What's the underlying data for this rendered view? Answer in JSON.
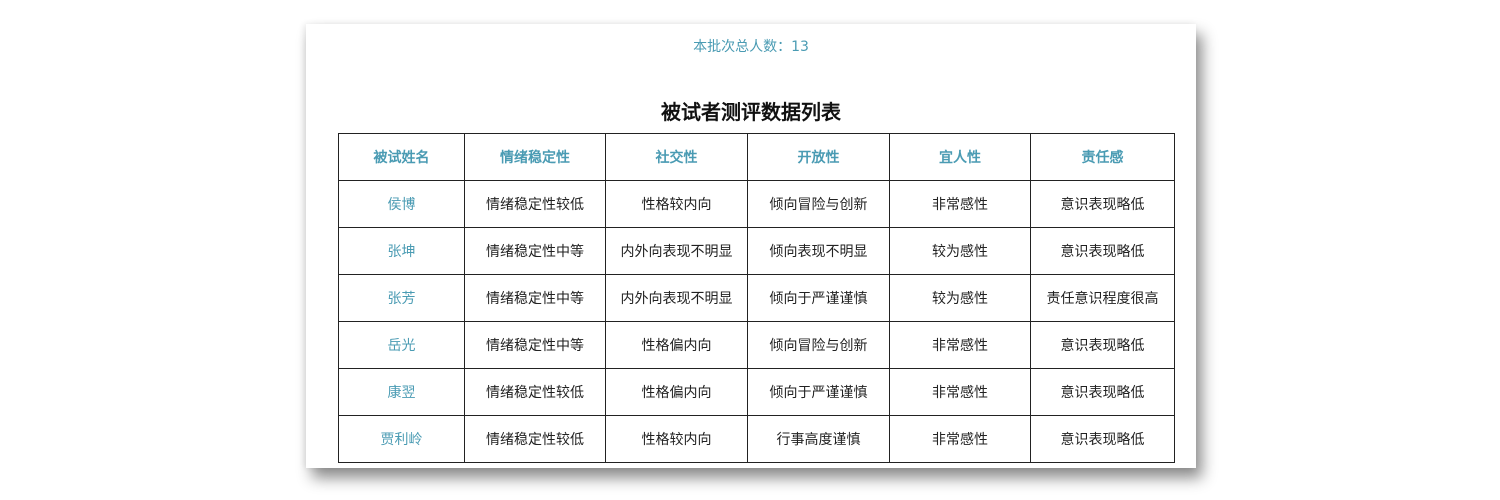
{
  "header": {
    "batch_total": "本批次总人数：13",
    "table_title": "被试者测评数据列表"
  },
  "table": {
    "columns": [
      "被试姓名",
      "情绪稳定性",
      "社交性",
      "开放性",
      "宜人性",
      "责任感"
    ],
    "rows": [
      [
        "侯博",
        "情绪稳定性较低",
        "性格较内向",
        "倾向冒险与创新",
        "非常感性",
        "意识表现略低"
      ],
      [
        "张坤",
        "情绪稳定性中等",
        "内外向表现不明显",
        "倾向表现不明显",
        "较为感性",
        "意识表现略低"
      ],
      [
        "张芳",
        "情绪稳定性中等",
        "内外向表现不明显",
        "倾向于严谨谨慎",
        "较为感性",
        "责任意识程度很高"
      ],
      [
        "岳光",
        "情绪稳定性中等",
        "性格偏内向",
        "倾向冒险与创新",
        "非常感性",
        "意识表现略低"
      ],
      [
        "康翌",
        "情绪稳定性较低",
        "性格偏内向",
        "倾向于严谨谨慎",
        "非常感性",
        "意识表现略低"
      ],
      [
        "贾利岭",
        "情绪稳定性较低",
        "性格较内向",
        "行事高度谨慎",
        "非常感性",
        "意识表现略低"
      ]
    ]
  },
  "colors": {
    "accent": "#4a9bb3",
    "text": "#222222",
    "border": "#222222"
  }
}
